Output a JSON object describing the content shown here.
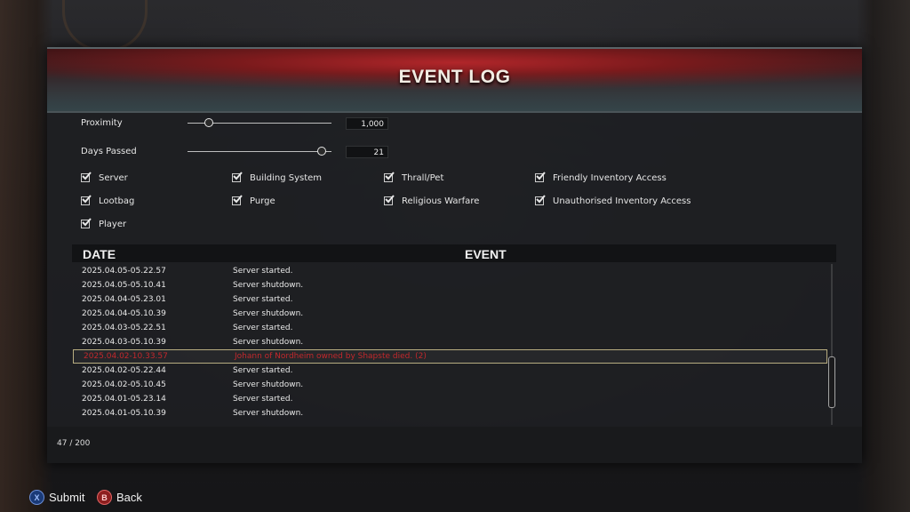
{
  "window": {
    "title": "EVENT LOG"
  },
  "filters": {
    "proximity": {
      "label": "Proximity",
      "value": "1,000",
      "slider_fraction": 0.15
    },
    "days_passed": {
      "label": "Days Passed",
      "value": "21",
      "slider_fraction": 0.93
    },
    "checkboxes": [
      {
        "label": "Server",
        "checked": true
      },
      {
        "label": "Building System",
        "checked": true
      },
      {
        "label": "Thrall/Pet",
        "checked": true
      },
      {
        "label": "Friendly Inventory Access",
        "checked": true
      },
      {
        "label": "Lootbag",
        "checked": true
      },
      {
        "label": "Purge",
        "checked": true
      },
      {
        "label": "Religious Warfare",
        "checked": true
      },
      {
        "label": "Unauthorised Inventory Access",
        "checked": true
      },
      {
        "label": "Player",
        "checked": true
      }
    ]
  },
  "table": {
    "columns": [
      "DATE",
      "EVENT"
    ],
    "rows": [
      {
        "date": "2025.04.05-05.22.57",
        "event": "Server started."
      },
      {
        "date": "2025.04.05-05.10.41",
        "event": "Server shutdown."
      },
      {
        "date": "2025.04.04-05.23.01",
        "event": "Server started."
      },
      {
        "date": "2025.04.04-05.10.39",
        "event": "Server shutdown."
      },
      {
        "date": "2025.04.03-05.22.51",
        "event": "Server started."
      },
      {
        "date": "2025.04.03-05.10.39",
        "event": "Server shutdown."
      },
      {
        "date": "2025.04.02-10.33.57",
        "event": "Johann of Nordheim owned by Shapste died. (2)",
        "selected": true,
        "color": "#c2282c"
      },
      {
        "date": "2025.04.02-05.22.44",
        "event": "Server started."
      },
      {
        "date": "2025.04.02-05.10.45",
        "event": "Server shutdown."
      },
      {
        "date": "2025.04.01-05.23.14",
        "event": "Server started."
      },
      {
        "date": "2025.04.01-05.10.39",
        "event": "Server shutdown."
      }
    ]
  },
  "counter": "47 / 200",
  "prompts": {
    "submit": {
      "icon": "x-button-icon",
      "glyph": "X",
      "label": "Submit"
    },
    "back": {
      "icon": "b-button-icon",
      "glyph": "B",
      "label": "Back"
    }
  }
}
